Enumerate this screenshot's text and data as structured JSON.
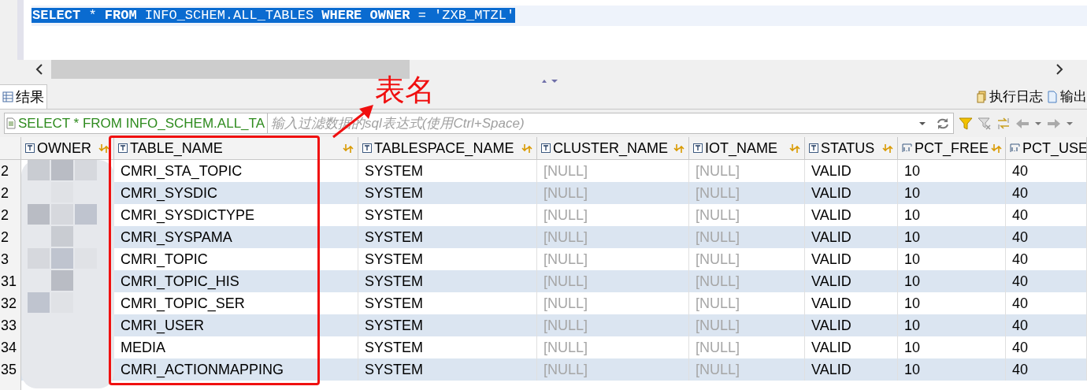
{
  "editor": {
    "sql": "**SELECT** * **FROM** INFO_SCHEM.ALL_TABLES **WHERE** **OWNER** = 'ZXB_MTZL'"
  },
  "tabs": [
    {
      "label": "结果",
      "selected": true
    }
  ],
  "right_tabs": [
    {
      "label": "执行日志",
      "kind": "log"
    },
    {
      "label": "输出",
      "kind": "output"
    }
  ],
  "filter": {
    "query": "SELECT * FROM INFO_SCHEM.ALL_TA",
    "placeholder": "输入过滤数据的sql表达式(使用Ctrl+Space)"
  },
  "table": {
    "columns": [
      {
        "label": "OWNER",
        "kind": "text"
      },
      {
        "label": "TABLE_NAME",
        "kind": "text"
      },
      {
        "label": "TABLESPACE_NAME",
        "kind": "text"
      },
      {
        "label": "CLUSTER_NAME",
        "kind": "text"
      },
      {
        "label": "IOT_NAME",
        "kind": "text"
      },
      {
        "label": "STATUS",
        "kind": "text"
      },
      {
        "label": "PCT_FREE",
        "kind": "number"
      },
      {
        "label": "PCT_USE",
        "kind": "number"
      }
    ],
    "rows": [
      {
        "row_number": "2",
        "cells": [
          "",
          "CMRI_STA_TOPIC",
          "SYSTEM",
          "[NULL]",
          "[NULL]",
          "VALID",
          "10",
          "40"
        ]
      },
      {
        "row_number": "2",
        "cells": [
          "",
          "CMRI_SYSDIC",
          "SYSTEM",
          "[NULL]",
          "[NULL]",
          "VALID",
          "10",
          "40"
        ]
      },
      {
        "row_number": "2",
        "cells": [
          "",
          "CMRI_SYSDICTYPE",
          "SYSTEM",
          "[NULL]",
          "[NULL]",
          "VALID",
          "10",
          "40"
        ]
      },
      {
        "row_number": "2",
        "cells": [
          "",
          "CMRI_SYSPAMA",
          "SYSTEM",
          "[NULL]",
          "[NULL]",
          "VALID",
          "10",
          "40"
        ]
      },
      {
        "row_number": "3",
        "cells": [
          "",
          "CMRI_TOPIC",
          "SYSTEM",
          "[NULL]",
          "[NULL]",
          "VALID",
          "10",
          "40"
        ]
      },
      {
        "row_number": "31",
        "cells": [
          "",
          "CMRI_TOPIC_HIS",
          "SYSTEM",
          "[NULL]",
          "[NULL]",
          "VALID",
          "10",
          "40"
        ]
      },
      {
        "row_number": "32",
        "cells": [
          "",
          "CMRI_TOPIC_SER",
          "SYSTEM",
          "[NULL]",
          "[NULL]",
          "VALID",
          "10",
          "40"
        ]
      },
      {
        "row_number": "33",
        "cells": [
          "",
          "CMRI_USER",
          "SYSTEM",
          "[NULL]",
          "[NULL]",
          "VALID",
          "10",
          "40"
        ]
      },
      {
        "row_number": "34",
        "cells": [
          "",
          "MEDIA",
          "SYSTEM",
          "[NULL]",
          "[NULL]",
          "VALID",
          "10",
          "40"
        ]
      },
      {
        "row_number": "35",
        "cells": [
          "",
          "CMRI_ACTIONMAPPING",
          "SYSTEM",
          "[NULL]",
          "[NULL]",
          "VALID",
          "10",
          "40"
        ]
      }
    ]
  },
  "annotation": {
    "label": "表名"
  }
}
